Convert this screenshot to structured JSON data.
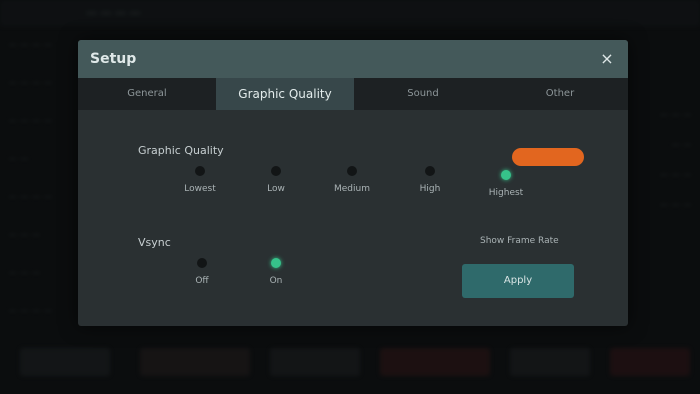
{
  "background": {
    "title": "— — — —",
    "sidebar": [
      "— — — —",
      "— — — —",
      "— — — —",
      "— —",
      "— — — —",
      "— — —",
      "— — —",
      "— — — —"
    ],
    "right": [
      "— — —",
      "— —",
      "— — —",
      "— — —"
    ]
  },
  "dialog": {
    "title": "Setup",
    "close_symbol": "×",
    "tabs": [
      "General",
      "Graphic Quality",
      "Sound",
      "Other"
    ],
    "active_tab": 1,
    "graphic_quality": {
      "label": "Graphic Quality",
      "options": [
        "Lowest",
        "Low",
        "Medium",
        "High",
        "Highest"
      ],
      "selected": 4
    },
    "vsync": {
      "label": "Vsync",
      "options": [
        "Off",
        "On"
      ],
      "selected": 1
    },
    "small_label": "Show Frame Rate",
    "apply_label": "Apply"
  },
  "colors": {
    "accent_orange": "#e2661f",
    "selected_green": "#36c28a",
    "header": "#44595a",
    "apply": "#2f6a6b"
  }
}
